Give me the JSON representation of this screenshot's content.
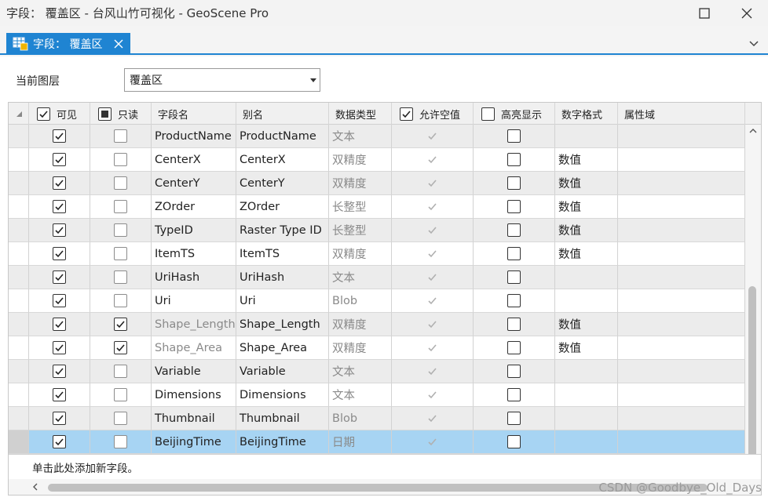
{
  "window": {
    "title": "字段： 覆盖区 - 台风山竹可视化 - GeoScene Pro"
  },
  "tab": {
    "label": "字段： 覆盖区"
  },
  "layer": {
    "label": "当前图层",
    "value": "覆盖区"
  },
  "columns": {
    "visible": "可见",
    "readonly": "只读",
    "field_name": "字段名",
    "alias": "别名",
    "data_type": "数据类型",
    "allow_null": "允许空值",
    "highlight": "高亮显示",
    "number_format": "数字格式",
    "domain": "属性域"
  },
  "rows": [
    {
      "name": "ProductName",
      "alias": "ProductName",
      "type": "文本",
      "format": "",
      "readonly": false
    },
    {
      "name": "CenterX",
      "alias": "CenterX",
      "type": "双精度",
      "format": "数值",
      "readonly": false
    },
    {
      "name": "CenterY",
      "alias": "CenterY",
      "type": "双精度",
      "format": "数值",
      "readonly": false
    },
    {
      "name": "ZOrder",
      "alias": "ZOrder",
      "type": "长整型",
      "format": "数值",
      "readonly": false
    },
    {
      "name": "TypeID",
      "alias": "Raster Type ID",
      "type": "长整型",
      "format": "数值",
      "readonly": false
    },
    {
      "name": "ItemTS",
      "alias": "ItemTS",
      "type": "双精度",
      "format": "数值",
      "readonly": false
    },
    {
      "name": "UriHash",
      "alias": "UriHash",
      "type": "文本",
      "format": "",
      "readonly": false
    },
    {
      "name": "Uri",
      "alias": "Uri",
      "type": "Blob",
      "format": "",
      "readonly": false
    },
    {
      "name": "Shape_Length",
      "alias": "Shape_Length",
      "type": "双精度",
      "format": "数值",
      "readonly": true
    },
    {
      "name": "Shape_Area",
      "alias": "Shape_Area",
      "type": "双精度",
      "format": "数值",
      "readonly": true
    },
    {
      "name": "Variable",
      "alias": "Variable",
      "type": "文本",
      "format": "",
      "readonly": false
    },
    {
      "name": "Dimensions",
      "alias": "Dimensions",
      "type": "文本",
      "format": "",
      "readonly": false
    },
    {
      "name": "Thumbnail",
      "alias": "Thumbnail",
      "type": "Blob",
      "format": "",
      "readonly": false
    },
    {
      "name": "BeijingTime",
      "alias": "BeijingTime",
      "type": "日期",
      "format": "",
      "readonly": false,
      "selected": true
    }
  ],
  "footer": {
    "add_field": "单击此处添加新字段。"
  },
  "watermark": "CSDN @Goodbye_Old_Days",
  "colors": {
    "accent": "#1f84d2",
    "selected_row": "#a7d4f3",
    "alt_row": "#ececec"
  }
}
